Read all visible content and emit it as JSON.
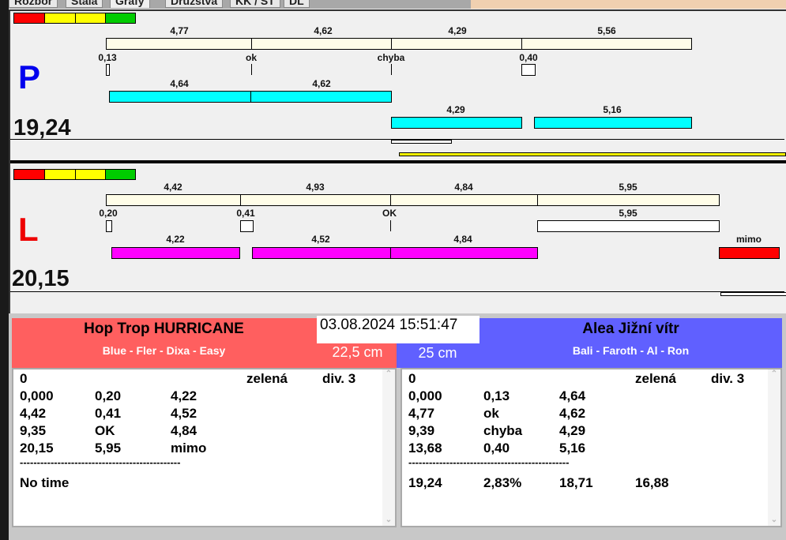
{
  "tabs": [
    "Rozbor",
    "Stála",
    "Grafy",
    "Družstva",
    "KK / ST",
    "DL"
  ],
  "colors": {
    "red": "#ff0000",
    "yellow": "#ffff00",
    "green": "#00cc00",
    "cyan": "#00ffff",
    "magenta": "#ff00ff",
    "team_left": "#ff5f5f",
    "team_right": "#6060ff"
  },
  "panel_p": {
    "letter": "P",
    "total": "19,24",
    "row1": [
      "4,77",
      "4,62",
      "4,29",
      "5,56"
    ],
    "row2": [
      "0,13",
      "ok",
      "chyba",
      "0,40"
    ],
    "row3": [
      "4,64",
      "4,62"
    ],
    "row4": [
      "4,29",
      "5,16"
    ]
  },
  "panel_l": {
    "letter": "L",
    "total": "20,15",
    "row1": [
      "4,42",
      "4,93",
      "4,84",
      "5,95"
    ],
    "row2": [
      "0,20",
      "0,41",
      "OK",
      "5,95"
    ],
    "row3": [
      "4,22",
      "4,52",
      "4,84"
    ],
    "row3_extra": "mimo"
  },
  "datetime": "03.08.2024 15:51:47",
  "left_team": {
    "name": "Hop Trop HURRICANE",
    "players": "Blue - Fler - Dixa - Easy",
    "distance": "22,5 cm",
    "header": [
      "0",
      "zelená",
      "div. 3"
    ],
    "rows": [
      [
        "0,000",
        "0,20",
        "4,22"
      ],
      [
        "4,42",
        "0,41",
        "4,52"
      ],
      [
        "9,35",
        "OK",
        "4,84"
      ],
      [
        "20,15",
        "5,95",
        "mimo"
      ]
    ],
    "separator": "-----------------------------------------------",
    "summary": [
      "No time"
    ]
  },
  "right_team": {
    "name": "Alea Jižní vítr",
    "players": "Bali - Faroth - Al - Ron",
    "distance": "25 cm",
    "header": [
      "0",
      "zelená",
      "div. 3"
    ],
    "rows": [
      [
        "0,000",
        "0,13",
        "4,64"
      ],
      [
        "4,77",
        "ok",
        "4,62"
      ],
      [
        "9,39",
        "chyba",
        "4,29"
      ],
      [
        "13,68",
        "0,40",
        "5,16"
      ]
    ],
    "separator": "-----------------------------------------------",
    "summary": [
      "19,24",
      "2,83%",
      "18,71",
      "16,88"
    ]
  }
}
